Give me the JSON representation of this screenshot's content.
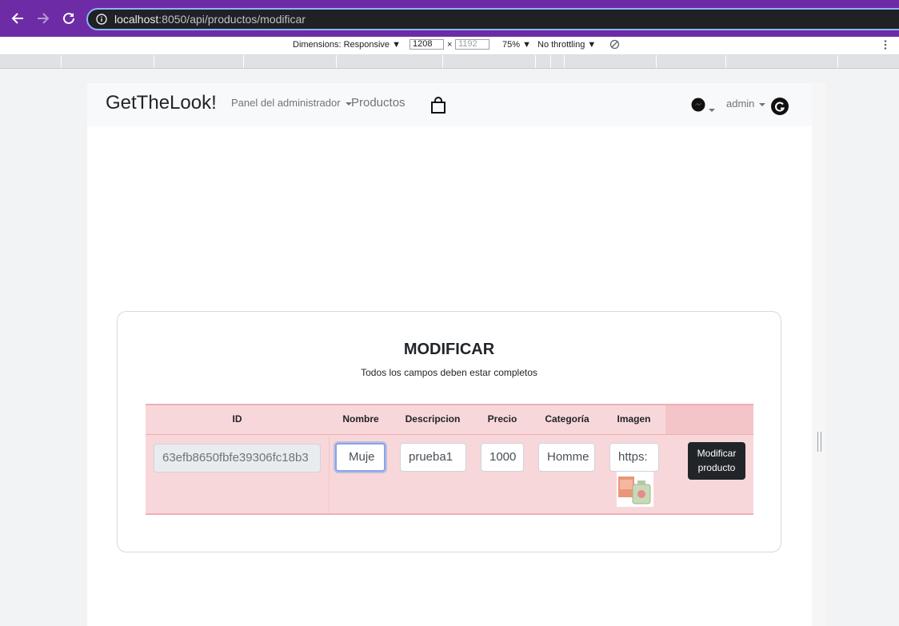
{
  "browser": {
    "url_host": "localhost",
    "url_rest": ":8050/api/productos/modificar"
  },
  "device_toolbar": {
    "dimensions_label": "Dimensions: Responsive ▼",
    "width_value": "1208",
    "times": "×",
    "height_placeholder": "1192",
    "zoom": "75% ▼",
    "throttling": "No throttling ▼"
  },
  "navbar": {
    "brand": "GetTheLook!",
    "admin_panel": "Panel del administrador",
    "products": "Productos",
    "user": "admin"
  },
  "card": {
    "title": "MODIFICAR",
    "subtitle": "Todos los campos deben estar completos"
  },
  "table": {
    "headers": [
      "ID",
      "Nombre",
      "Descripcion",
      "Precio",
      "Categoría",
      "Imagen"
    ],
    "row": {
      "id": "63efb8650fbfe39306fc18b3",
      "nombre": "Muje",
      "descripcion": "prueba1",
      "precio": "1000",
      "categoria": "Homme",
      "imagen": "https:"
    },
    "button": "Modificar producto"
  },
  "colors": {
    "browser_bar": "#6d2ca6",
    "table_bg": "#f8d7da",
    "button_bg": "#212529"
  }
}
